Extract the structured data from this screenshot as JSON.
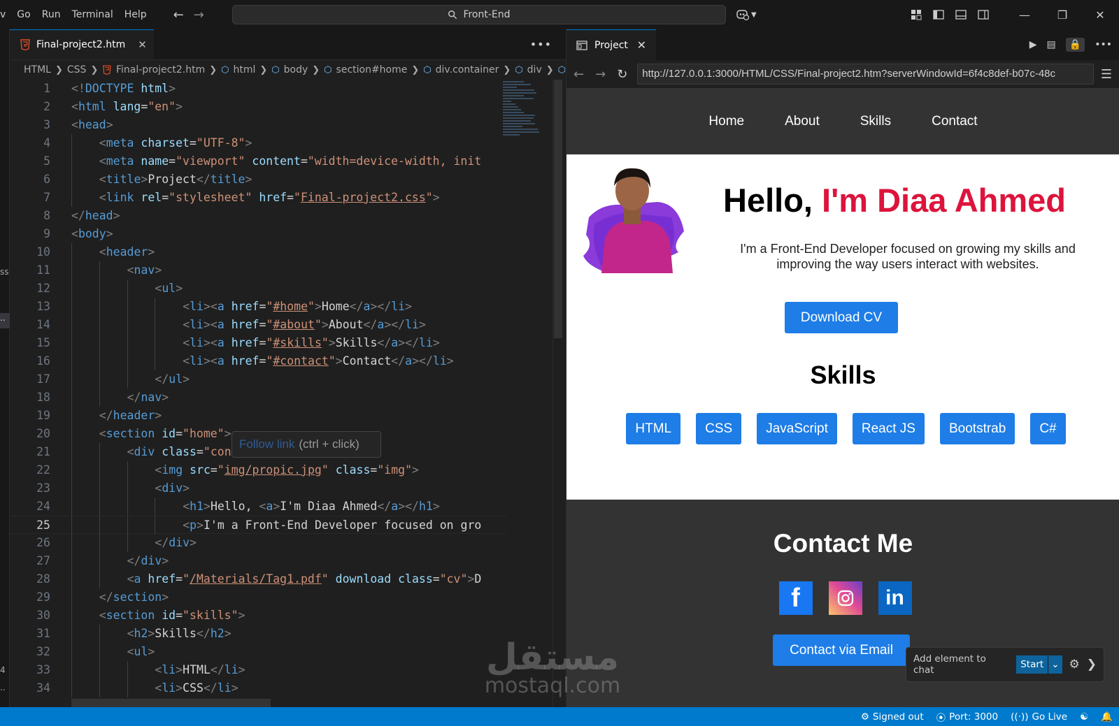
{
  "menu": [
    "v",
    "Go",
    "Run",
    "Terminal",
    "Help"
  ],
  "search": {
    "label": "Front-End"
  },
  "editor": {
    "tab": {
      "label": "Final-project2.htm"
    },
    "breadcrumb": [
      "HTML",
      "CSS",
      "Final-project2.htm",
      "html",
      "body",
      "section#home",
      "div.container",
      "div"
    ],
    "active_line": 25,
    "tooltip": {
      "link_text": "Follow link",
      "hint": "(ctrl + click)"
    },
    "lines": [
      {
        "n": 1,
        "indent": 0,
        "tokens": [
          [
            "t",
            "<!"
          ],
          [
            "tg",
            "DOCTYPE"
          ],
          [
            "tx",
            " "
          ],
          [
            "at",
            "html"
          ],
          [
            "t",
            ">"
          ]
        ]
      },
      {
        "n": 2,
        "indent": 0,
        "tokens": [
          [
            "t",
            "<"
          ],
          [
            "tg",
            "html"
          ],
          [
            "tx",
            " "
          ],
          [
            "at",
            "lang"
          ],
          [
            "tx",
            "="
          ],
          [
            "st",
            "\"en\""
          ],
          [
            "t",
            ">"
          ]
        ]
      },
      {
        "n": 3,
        "indent": 0,
        "tokens": [
          [
            "t",
            "<"
          ],
          [
            "tg",
            "head"
          ],
          [
            "t",
            ">"
          ]
        ]
      },
      {
        "n": 4,
        "indent": 1,
        "tokens": [
          [
            "t",
            "<"
          ],
          [
            "tg",
            "meta"
          ],
          [
            "tx",
            " "
          ],
          [
            "at",
            "charset"
          ],
          [
            "tx",
            "="
          ],
          [
            "st",
            "\"UTF-8\""
          ],
          [
            "t",
            ">"
          ]
        ]
      },
      {
        "n": 5,
        "indent": 1,
        "tokens": [
          [
            "t",
            "<"
          ],
          [
            "tg",
            "meta"
          ],
          [
            "tx",
            " "
          ],
          [
            "at",
            "name"
          ],
          [
            "tx",
            "="
          ],
          [
            "st",
            "\"viewport\""
          ],
          [
            "tx",
            " "
          ],
          [
            "at",
            "content"
          ],
          [
            "tx",
            "="
          ],
          [
            "st",
            "\"width=device-width, init"
          ]
        ]
      },
      {
        "n": 6,
        "indent": 1,
        "tokens": [
          [
            "t",
            "<"
          ],
          [
            "tg",
            "title"
          ],
          [
            "t",
            ">"
          ],
          [
            "tx",
            "Project"
          ],
          [
            "t",
            "</"
          ],
          [
            "tg",
            "title"
          ],
          [
            "t",
            ">"
          ]
        ]
      },
      {
        "n": 7,
        "indent": 1,
        "tokens": [
          [
            "t",
            "<"
          ],
          [
            "tg",
            "link"
          ],
          [
            "tx",
            " "
          ],
          [
            "at",
            "rel"
          ],
          [
            "tx",
            "="
          ],
          [
            "st",
            "\"stylesheet\""
          ],
          [
            "tx",
            " "
          ],
          [
            "at",
            "href"
          ],
          [
            "tx",
            "="
          ],
          [
            "st",
            "\""
          ],
          [
            "st ul",
            "Final-project2.css"
          ],
          [
            "st",
            "\""
          ],
          [
            "t",
            ">"
          ]
        ]
      },
      {
        "n": 8,
        "indent": 0,
        "tokens": [
          [
            "t",
            "</"
          ],
          [
            "tg",
            "head"
          ],
          [
            "t",
            ">"
          ]
        ]
      },
      {
        "n": 9,
        "indent": 0,
        "tokens": [
          [
            "t",
            "<"
          ],
          [
            "tg",
            "body"
          ],
          [
            "t",
            ">"
          ]
        ]
      },
      {
        "n": 10,
        "indent": 1,
        "tokens": [
          [
            "t",
            "<"
          ],
          [
            "tg",
            "header"
          ],
          [
            "t",
            ">"
          ]
        ]
      },
      {
        "n": 11,
        "indent": 2,
        "tokens": [
          [
            "t",
            "<"
          ],
          [
            "tg",
            "nav"
          ],
          [
            "t",
            ">"
          ]
        ]
      },
      {
        "n": 12,
        "indent": 3,
        "tokens": [
          [
            "t",
            "<"
          ],
          [
            "tg",
            "ul"
          ],
          [
            "t",
            ">"
          ]
        ]
      },
      {
        "n": 13,
        "indent": 4,
        "tokens": [
          [
            "t",
            "<"
          ],
          [
            "tg",
            "li"
          ],
          [
            "t",
            "><"
          ],
          [
            "tg",
            "a"
          ],
          [
            "tx",
            " "
          ],
          [
            "at",
            "href"
          ],
          [
            "tx",
            "="
          ],
          [
            "st",
            "\""
          ],
          [
            "st ul",
            "#home"
          ],
          [
            "st",
            "\""
          ],
          [
            "t",
            ">"
          ],
          [
            "tx",
            "Home"
          ],
          [
            "t",
            "</"
          ],
          [
            "tg",
            "a"
          ],
          [
            "t",
            "></"
          ],
          [
            "tg",
            "li"
          ],
          [
            "t",
            ">"
          ]
        ]
      },
      {
        "n": 14,
        "indent": 4,
        "tokens": [
          [
            "t",
            "<"
          ],
          [
            "tg",
            "li"
          ],
          [
            "t",
            "><"
          ],
          [
            "tg",
            "a"
          ],
          [
            "tx",
            " "
          ],
          [
            "at",
            "href"
          ],
          [
            "tx",
            "="
          ],
          [
            "st",
            "\""
          ],
          [
            "st ul",
            "#about"
          ],
          [
            "st",
            "\""
          ],
          [
            "t",
            ">"
          ],
          [
            "tx",
            "About"
          ],
          [
            "t",
            "</"
          ],
          [
            "tg",
            "a"
          ],
          [
            "t",
            "></"
          ],
          [
            "tg",
            "li"
          ],
          [
            "t",
            ">"
          ]
        ]
      },
      {
        "n": 15,
        "indent": 4,
        "tokens": [
          [
            "t",
            "<"
          ],
          [
            "tg",
            "li"
          ],
          [
            "t",
            "><"
          ],
          [
            "tg",
            "a"
          ],
          [
            "tx",
            " "
          ],
          [
            "at",
            "href"
          ],
          [
            "tx",
            "="
          ],
          [
            "st",
            "\""
          ],
          [
            "st ul",
            "#skills"
          ],
          [
            "st",
            "\""
          ],
          [
            "t",
            ">"
          ],
          [
            "tx",
            "Skills"
          ],
          [
            "t",
            "</"
          ],
          [
            "tg",
            "a"
          ],
          [
            "t",
            "></"
          ],
          [
            "tg",
            "li"
          ],
          [
            "t",
            ">"
          ]
        ]
      },
      {
        "n": 16,
        "indent": 4,
        "tokens": [
          [
            "t",
            "<"
          ],
          [
            "tg",
            "li"
          ],
          [
            "t",
            "><"
          ],
          [
            "tg",
            "a"
          ],
          [
            "tx",
            " "
          ],
          [
            "at",
            "href"
          ],
          [
            "tx",
            "="
          ],
          [
            "st",
            "\""
          ],
          [
            "st ul",
            "#contact"
          ],
          [
            "st",
            "\""
          ],
          [
            "t",
            ">"
          ],
          [
            "tx",
            "Contact"
          ],
          [
            "t",
            "</"
          ],
          [
            "tg",
            "a"
          ],
          [
            "t",
            "></"
          ],
          [
            "tg",
            "li"
          ],
          [
            "t",
            ">"
          ]
        ]
      },
      {
        "n": 17,
        "indent": 3,
        "tokens": [
          [
            "t",
            "</"
          ],
          [
            "tg",
            "ul"
          ],
          [
            "t",
            ">"
          ]
        ]
      },
      {
        "n": 18,
        "indent": 2,
        "tokens": [
          [
            "t",
            "</"
          ],
          [
            "tg",
            "nav"
          ],
          [
            "t",
            ">"
          ]
        ]
      },
      {
        "n": 19,
        "indent": 1,
        "tokens": [
          [
            "t",
            "</"
          ],
          [
            "tg",
            "header"
          ],
          [
            "t",
            ">"
          ]
        ]
      },
      {
        "n": 20,
        "indent": 1,
        "tokens": [
          [
            "t",
            "<"
          ],
          [
            "tg",
            "section"
          ],
          [
            "tx",
            " "
          ],
          [
            "at",
            "id"
          ],
          [
            "tx",
            "="
          ],
          [
            "st",
            "\"home\""
          ],
          [
            "t",
            ">"
          ]
        ]
      },
      {
        "n": 21,
        "indent": 2,
        "tokens": [
          [
            "t",
            "<"
          ],
          [
            "tg",
            "div"
          ],
          [
            "tx",
            " "
          ],
          [
            "at",
            "class"
          ],
          [
            "tx",
            "="
          ],
          [
            "st",
            "\"container\""
          ],
          [
            "t",
            ">"
          ]
        ]
      },
      {
        "n": 22,
        "indent": 3,
        "tokens": [
          [
            "t",
            "<"
          ],
          [
            "tg",
            "img"
          ],
          [
            "tx",
            " "
          ],
          [
            "at",
            "src"
          ],
          [
            "tx",
            "="
          ],
          [
            "st",
            "\""
          ],
          [
            "st ul",
            "img/propic.jpg"
          ],
          [
            "st",
            "\""
          ],
          [
            "tx",
            " "
          ],
          [
            "at",
            "class"
          ],
          [
            "tx",
            "="
          ],
          [
            "st",
            "\"img\""
          ],
          [
            "t",
            ">"
          ]
        ]
      },
      {
        "n": 23,
        "indent": 3,
        "tokens": [
          [
            "t",
            "<"
          ],
          [
            "tg",
            "div"
          ],
          [
            "t",
            ">"
          ]
        ]
      },
      {
        "n": 24,
        "indent": 4,
        "tokens": [
          [
            "t",
            "<"
          ],
          [
            "tg",
            "h1"
          ],
          [
            "t",
            ">"
          ],
          [
            "tx",
            "Hello, "
          ],
          [
            "t",
            "<"
          ],
          [
            "tg",
            "a"
          ],
          [
            "t",
            ">"
          ],
          [
            "tx",
            "I'm Diaa Ahmed"
          ],
          [
            "t",
            "</"
          ],
          [
            "tg",
            "a"
          ],
          [
            "t",
            "></"
          ],
          [
            "tg",
            "h1"
          ],
          [
            "t",
            ">"
          ]
        ]
      },
      {
        "n": 25,
        "indent": 4,
        "tokens": [
          [
            "t",
            "<"
          ],
          [
            "tg",
            "p"
          ],
          [
            "t",
            ">"
          ],
          [
            "tx",
            "I'm a Front-End Developer focused on gro"
          ]
        ]
      },
      {
        "n": 26,
        "indent": 3,
        "tokens": [
          [
            "t",
            "</"
          ],
          [
            "tg",
            "div"
          ],
          [
            "t",
            ">"
          ]
        ]
      },
      {
        "n": 27,
        "indent": 2,
        "tokens": [
          [
            "t",
            "</"
          ],
          [
            "tg",
            "div"
          ],
          [
            "t",
            ">"
          ]
        ]
      },
      {
        "n": 28,
        "indent": 2,
        "tokens": [
          [
            "t",
            "<"
          ],
          [
            "tg",
            "a"
          ],
          [
            "tx",
            " "
          ],
          [
            "at",
            "href"
          ],
          [
            "tx",
            "="
          ],
          [
            "st",
            "\""
          ],
          [
            "st ul",
            "/Materials/Tag1.pdf"
          ],
          [
            "st",
            "\""
          ],
          [
            "tx",
            " "
          ],
          [
            "at",
            "download"
          ],
          [
            "tx",
            " "
          ],
          [
            "at",
            "class"
          ],
          [
            "tx",
            "="
          ],
          [
            "st",
            "\"cv\""
          ],
          [
            "t",
            ">"
          ],
          [
            "tx",
            "D"
          ]
        ]
      },
      {
        "n": 29,
        "indent": 1,
        "tokens": [
          [
            "t",
            "</"
          ],
          [
            "tg",
            "section"
          ],
          [
            "t",
            ">"
          ]
        ]
      },
      {
        "n": 30,
        "indent": 1,
        "tokens": [
          [
            "t",
            "<"
          ],
          [
            "tg",
            "section"
          ],
          [
            "tx",
            " "
          ],
          [
            "at",
            "id"
          ],
          [
            "tx",
            "="
          ],
          [
            "st",
            "\"skills\""
          ],
          [
            "t",
            ">"
          ]
        ]
      },
      {
        "n": 31,
        "indent": 2,
        "tokens": [
          [
            "t",
            "<"
          ],
          [
            "tg",
            "h2"
          ],
          [
            "t",
            ">"
          ],
          [
            "tx",
            "Skills"
          ],
          [
            "t",
            "</"
          ],
          [
            "tg",
            "h2"
          ],
          [
            "t",
            ">"
          ]
        ]
      },
      {
        "n": 32,
        "indent": 2,
        "tokens": [
          [
            "t",
            "<"
          ],
          [
            "tg",
            "ul"
          ],
          [
            "t",
            ">"
          ]
        ]
      },
      {
        "n": 33,
        "indent": 3,
        "tokens": [
          [
            "t",
            "<"
          ],
          [
            "tg",
            "li"
          ],
          [
            "t",
            ">"
          ],
          [
            "tx",
            "HTML"
          ],
          [
            "t",
            "</"
          ],
          [
            "tg",
            "li"
          ],
          [
            "t",
            ">"
          ]
        ]
      },
      {
        "n": 34,
        "indent": 3,
        "tokens": [
          [
            "t",
            "<"
          ],
          [
            "tg",
            "li"
          ],
          [
            "t",
            ">"
          ],
          [
            "tx",
            "CSS"
          ],
          [
            "t",
            "</"
          ],
          [
            "tg",
            "li"
          ],
          [
            "t",
            ">"
          ]
        ]
      }
    ]
  },
  "preview": {
    "tab": {
      "label": "Project"
    },
    "url": "http://127.0.0.1:3000/HTML/CSS/Final-project2.htm?serverWindowId=6f4c8def-b07c-48c",
    "site": {
      "nav": [
        "Home",
        "About",
        "Skills",
        "Contact"
      ],
      "hello": "Hello, ",
      "name": "I'm Diaa Ahmed",
      "intro": "I'm a Front-End Developer focused on growing my skills and improving the way users interact with websites.",
      "cv_button": "Download CV",
      "skills_title": "Skills",
      "skills": [
        "HTML",
        "CSS",
        "JavaScript",
        "React JS",
        "Bootstrab",
        "C#"
      ],
      "contact_title": "Contact Me",
      "social_icons": [
        "facebook-icon",
        "instagram-icon",
        "linkedin-icon"
      ],
      "email_button": "Contact via Email"
    },
    "chatbar": {
      "label": "Add element to chat",
      "start": "Start"
    }
  },
  "watermark": {
    "arabic": "مستقل",
    "latin": "mostaql.com"
  },
  "statusbar": {
    "signed_out": "Signed out",
    "port": "Port: 3000",
    "go_live": "Go Live"
  },
  "colors": {
    "accent": "#007acc",
    "button_blue": "#1e7de6",
    "name_red": "#dc143c",
    "site_dark": "#333333"
  }
}
